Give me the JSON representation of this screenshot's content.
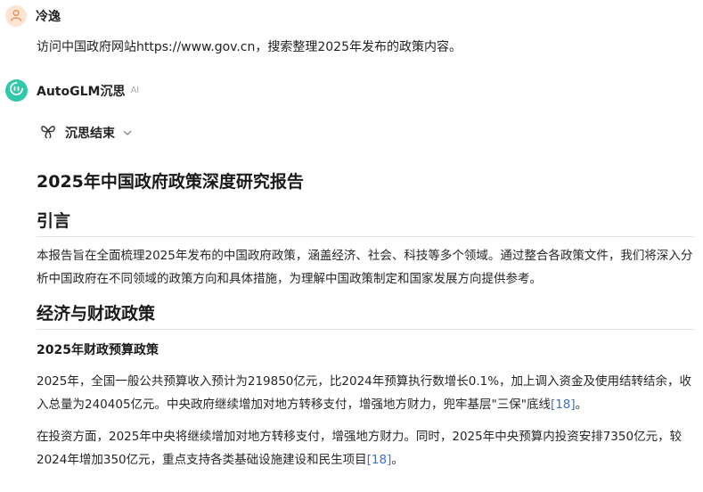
{
  "user": {
    "name": "冷逸",
    "message": "访问中国政府网站https://www.gov.cn，搜索整理2025年发布的政策内容。",
    "avatar_icon": "user-icon",
    "avatar_color": "#fde4d3",
    "avatar_icon_color": "#e8915a"
  },
  "assistant": {
    "name": "AutoGLM沉思",
    "tag": "AI",
    "avatar_icon": "glm-logo-icon",
    "avatar_color": "#2fc8a8",
    "thinking_status": "沉思结束",
    "thinking_icon": "butterfly-icon",
    "expand_icon": "chevron-down-icon"
  },
  "report": {
    "title": "2025年中国政府政策深度研究报告",
    "intro_heading": "引言",
    "intro_text": "本报告旨在全面梳理2025年发布的中国政府政策，涵盖经济、社会、科技等多个领域。通过整合各政策文件，我们将深入分析中国政府在不同领域的政策方向和具体措施，为理解中国政策制定和国家发展方向提供参考。",
    "econ_heading": "经济与财政政策",
    "budget_heading": "2025年财政预算政策",
    "budget_p1_text": "2025年，全国一般公共预算收入预计为219850亿元，比2024年预算执行数增长0.1%，加上调入资金及使用结转结余，收入总量为240405亿元。中央政府继续增加对地方转移支付，增强地方财力，兜牢基层\"三保\"底线",
    "budget_p1_ref": "[18]",
    "budget_p1_end": "。",
    "budget_p2_text": "在投资方面，2025年中央将继续增加对地方转移支付，增强地方财力。同时，2025年中央预算内投资安排7350亿元，较2024年增加350亿元，重点支持各类基础设施建设和民生项目",
    "budget_p2_ref": "[18]",
    "budget_p2_end": "。",
    "link_color": "#3b6fd8"
  }
}
